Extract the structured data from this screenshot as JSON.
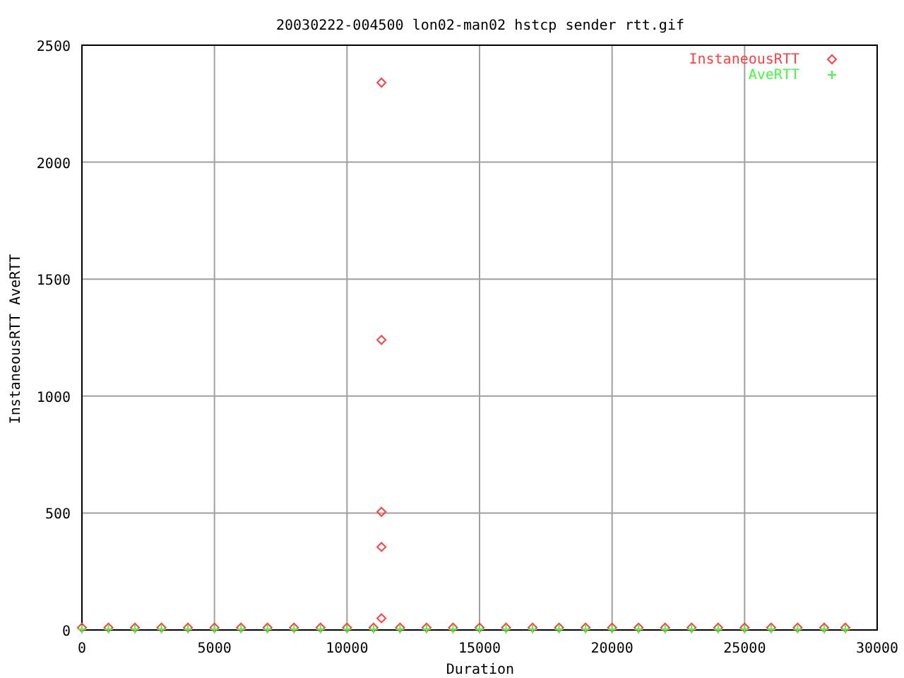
{
  "chart_data": {
    "type": "scatter",
    "title": "20030222-004500 lon02-man02 hstcp sender rtt.gif",
    "xlabel": "Duration",
    "ylabel": "InstaneousRTT AveRTT",
    "x": [
      0,
      1000,
      2000,
      3000,
      4000,
      5000,
      6000,
      7000,
      8000,
      9000,
      10000,
      11000,
      12000,
      13000,
      14000,
      15000,
      16000,
      17000,
      18000,
      19000,
      20000,
      21000,
      22000,
      23000,
      24000,
      25000,
      26000,
      27000,
      28000,
      28800,
      11300,
      11300,
      11300,
      11300,
      11300
    ],
    "series": [
      {
        "name": "InstaneousRTT",
        "color": "#ff4040",
        "values": [
          10,
          10,
          10,
          10,
          10,
          10,
          10,
          10,
          10,
          10,
          10,
          10,
          10,
          10,
          10,
          10,
          10,
          10,
          10,
          10,
          10,
          10,
          10,
          10,
          10,
          10,
          10,
          10,
          10,
          10,
          2340,
          1240,
          505,
          355,
          50
        ]
      },
      {
        "name": "AveRTT",
        "color": "#40ff40",
        "values": [
          3,
          3,
          3,
          3,
          3,
          3,
          3,
          3,
          3,
          3,
          3,
          3,
          3,
          3,
          3,
          3,
          3,
          3,
          3,
          3,
          3,
          3,
          3,
          3,
          3,
          3,
          3,
          3,
          3,
          3,
          null,
          null,
          null,
          null,
          null
        ]
      }
    ],
    "xlim": [
      0,
      30000
    ],
    "ylim": [
      0,
      2500
    ],
    "xticks": [
      0,
      5000,
      10000,
      15000,
      20000,
      25000,
      30000
    ],
    "yticks": [
      0,
      500,
      1000,
      1500,
      2000,
      2500
    ],
    "grid": true,
    "legend": "top-right"
  }
}
